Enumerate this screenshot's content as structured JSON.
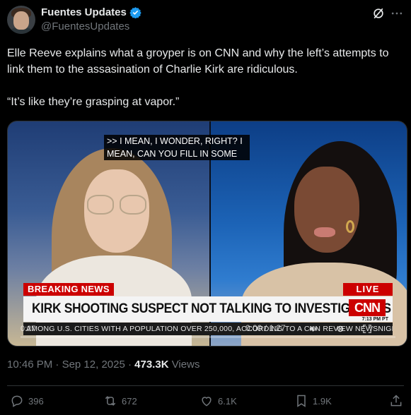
{
  "author": {
    "display_name": "Fuentes Updates",
    "handle": "@FuentesUpdates",
    "verified": true
  },
  "tweet": {
    "paragraphs": [
      "Elle Reeve explains what a groyper is on CNN and why the left’s attempts to link them to the assasination of Charlie Kirk are ridiculous.",
      "“It’s like they’re grasping at vapor.”"
    ]
  },
  "video": {
    "caption_lines": [
      ">> I MEAN, I WONDER, RIGHT? I",
      "MEAN, CAN YOU FILL IN SOME"
    ],
    "breaking_label": "BREAKING NEWS",
    "live_label": "LIVE",
    "headline": "KIRK SHOOTING SUSPECT NOT TALKING TO INVESTIGATORS",
    "network_logo": "CNN",
    "broadcast_time": "7:13 PM PT",
    "ticker": "AMONG U.S. CITIES WITH A POPULATION OVER 250,000, ACCORDING TO A CNN REVIEW   NEWSNIGHT",
    "elapsed_left": "0:27",
    "time_display": "0:00 / 1:27",
    "progress": 0.0
  },
  "meta": {
    "time": "10:46 PM",
    "date": "Sep 12, 2025",
    "separator": "·",
    "views_count": "473.3K",
    "views_label": "Views"
  },
  "actions": {
    "replies": "396",
    "reposts": "672",
    "likes": "6.1K",
    "bookmarks": "1.9K"
  },
  "colors": {
    "background": "#000000",
    "verified_blue": "#1d9bf0",
    "secondary_text": "#71767b",
    "cnn_red": "#cc0000"
  },
  "icons": [
    "verified-badge-icon",
    "grok-icon",
    "more-icon",
    "reply-icon",
    "repost-icon",
    "like-icon",
    "bookmark-icon",
    "share-icon",
    "volume-icon",
    "settings-icon",
    "fullscreen-icon"
  ]
}
